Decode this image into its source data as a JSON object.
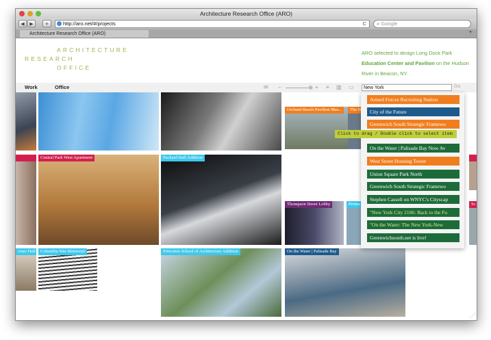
{
  "window": {
    "title": "Architecture Research Office (ARO)"
  },
  "browser": {
    "back": "◀",
    "forward": "▶",
    "add": "+",
    "url": "http://aro.net/#/projects",
    "reload": "C",
    "search_placeholder": "Google",
    "tab_label": "Architecture Research Office (ARO)",
    "new_tab": "+"
  },
  "logo": {
    "line1": "ARCHITECTURE",
    "line2": "RESEARCH",
    "line3": "OFFICE"
  },
  "news": {
    "part1": "ARO selected to design Long Dock Park",
    "part2": "Education Center and Pavilion",
    "part3": "on the Hudson River in Beacon, NY."
  },
  "nav": {
    "work": "Work",
    "office": "Office",
    "go": "Go"
  },
  "search": {
    "value": "New York"
  },
  "tiles": [
    {
      "label": "Orchard Beach Pavilion Mas...",
      "color": "#f07e1e"
    },
    {
      "label": "The Ba",
      "color": "#f07e1e"
    },
    {
      "label": "Central Park West Apartment",
      "color": "#d21f4f"
    },
    {
      "label": "Packard Hall Addition",
      "color": "#3fc8ec"
    },
    {
      "label": "Thompson Street Lobby",
      "color": "#6e2a73"
    },
    {
      "label": "Perma",
      "color": "#3fc8ec"
    },
    {
      "label": "cture Hall",
      "color": "#3fc8ec"
    },
    {
      "label": "Columbia War Memorial",
      "color": "#3fc8ec"
    },
    {
      "label": "Princeton School of Architecture Addition",
      "color": "#3fc8ec"
    },
    {
      "label": "On the Water | Palisade Bay",
      "color": "#1d5a8c"
    },
    {
      "label": "Sc",
      "color": "#d21f4f"
    }
  ],
  "tooltip": "Click to drag / Double click to select item",
  "results": [
    {
      "label": "Armed Forces Recruiting Station",
      "color": "#f07e1e"
    },
    {
      "label": "City of the Future",
      "color": "#1d5a8c"
    },
    {
      "label": "Greenwich South Strategic Framewo",
      "color": "#f07e1e"
    },
    {
      "label": "On the Water | Palisade Bay Now Av",
      "color": "#1e6b3a"
    },
    {
      "label": "West Street Housing Tower",
      "color": "#f07e1e"
    },
    {
      "label": "Union Square Park North",
      "color": "#1e6b3a"
    },
    {
      "label": "Greenwich South Strategic Framewo",
      "color": "#1e6b3a"
    },
    {
      "label": "Stephen Cassell on WNYC's Cityscap",
      "color": "#1e6b3a"
    },
    {
      "label": "\"New York City 2106: Back to the Fu",
      "color": "#1e6b3a"
    },
    {
      "label": "\"On the Water: The New York-New",
      "color": "#1e6b3a"
    },
    {
      "label": "Greenwichsouth.net is live!",
      "color": "#1e6b3a"
    }
  ]
}
